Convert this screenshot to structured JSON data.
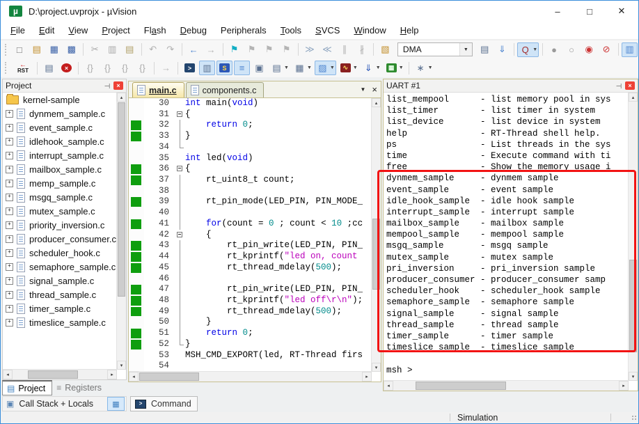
{
  "window": {
    "title": "D:\\project.uvprojx - µVision"
  },
  "menu": {
    "items": [
      {
        "label": "File",
        "u": 0
      },
      {
        "label": "Edit",
        "u": 0
      },
      {
        "label": "View",
        "u": 0
      },
      {
        "label": "Project",
        "u": 0
      },
      {
        "label": "Flash",
        "u": 2
      },
      {
        "label": "Debug",
        "u": 0
      },
      {
        "label": "Peripherals",
        "u": -1
      },
      {
        "label": "Tools",
        "u": 0
      },
      {
        "label": "SVCS",
        "u": 0
      },
      {
        "label": "Window",
        "u": 0
      },
      {
        "label": "Help",
        "u": 0
      }
    ]
  },
  "toolbars": {
    "target_value": "DMA",
    "main": [
      {
        "n": "new-file-icon",
        "g": "□",
        "c": "#6f6f6f"
      },
      {
        "n": "open-file-icon",
        "g": "▤",
        "c": "#c28f2c"
      },
      {
        "n": "save-icon",
        "g": "▦",
        "c": "#3b62a8"
      },
      {
        "n": "save-all-icon",
        "g": "▩",
        "c": "#3b62a8"
      },
      {
        "t": "sep"
      },
      {
        "n": "cut-icon",
        "g": "✂",
        "c": "#a9a9a9"
      },
      {
        "n": "copy-icon",
        "g": "▥",
        "c": "#a9a9a9"
      },
      {
        "n": "paste-icon",
        "g": "▤",
        "c": "#b1a06a"
      },
      {
        "t": "sep"
      },
      {
        "n": "undo-icon",
        "g": "↶",
        "c": "#b0b0b0"
      },
      {
        "n": "redo-icon",
        "g": "↷",
        "c": "#b0b0b0"
      },
      {
        "t": "sep"
      },
      {
        "n": "navigate-back-icon",
        "g": "←",
        "c": "#4f86d0"
      },
      {
        "n": "navigate-forward-icon",
        "g": "→",
        "c": "#b4b4b4"
      },
      {
        "t": "sep"
      },
      {
        "n": "bookmark-toggle-icon",
        "g": "⚑",
        "c": "#12aec4"
      },
      {
        "n": "bookmark-prev-icon",
        "g": "⚑",
        "c": "#b4b4b4"
      },
      {
        "n": "bookmark-next-icon",
        "g": "⚑",
        "c": "#b4b4b4"
      },
      {
        "n": "bookmark-clear-icon",
        "g": "⚑",
        "c": "#b4b4b4"
      },
      {
        "t": "sep"
      },
      {
        "n": "indent-icon",
        "g": "≫",
        "c": "#93a9c2"
      },
      {
        "n": "outdent-icon",
        "g": "≪",
        "c": "#93a9c2"
      },
      {
        "n": "comment-icon",
        "g": "∥",
        "c": "#b0b0b0"
      },
      {
        "n": "uncomment-icon",
        "g": "∦",
        "c": "#b0b0b0"
      },
      {
        "t": "sep"
      },
      {
        "n": "flash-download-icon",
        "g": "▧",
        "c": "#c28f2c"
      },
      {
        "t": "combo"
      },
      {
        "n": "target-options-icon",
        "g": "▤",
        "c": "#5a7090"
      },
      {
        "n": "find-in-files-icon",
        "g": "⇓",
        "c": "#4f86d0"
      },
      {
        "t": "sep"
      },
      {
        "n": "search-icon",
        "g": "Q",
        "c": "#a32c2c",
        "hl": 1,
        "dd": 1
      },
      {
        "t": "sep"
      },
      {
        "n": "breakpoint-insert-icon",
        "g": "●",
        "c": "#9a9a9a"
      },
      {
        "n": "breakpoint-remove-icon",
        "g": "○",
        "c": "#9a9a9a"
      },
      {
        "n": "breakpoint-enable-icon",
        "g": "◉",
        "c": "#c33"
      },
      {
        "n": "breakpoint-kill-icon",
        "g": "⊘",
        "c": "#c33"
      },
      {
        "t": "sep"
      },
      {
        "n": "window-layout-icon",
        "g": "▥",
        "c": "#4f86d0",
        "hl": 1
      }
    ],
    "debug": [
      {
        "t": "rst",
        "n": "reset-cpu-button",
        "label": "RST",
        "arrow": "←"
      },
      {
        "t": "sep"
      },
      {
        "n": "run-to-line-icon",
        "g": "▤",
        "c": "#5a7090"
      },
      {
        "n": "stop-icon",
        "g": "×",
        "c": "#fff",
        "bg": "#c41e1e",
        "round": 1
      },
      {
        "t": "sep"
      },
      {
        "n": "step-icon",
        "g": "{}",
        "c": "#ababab"
      },
      {
        "n": "step-over-icon",
        "g": "{}",
        "c": "#ababab"
      },
      {
        "n": "step-out-icon",
        "g": "{}",
        "c": "#ababab"
      },
      {
        "n": "run-to-cursor-icon",
        "g": "{}",
        "c": "#ababab"
      },
      {
        "t": "sep"
      },
      {
        "n": "next-statement-icon",
        "g": "→",
        "c": "#b8b8b8"
      },
      {
        "t": "sep"
      },
      {
        "n": "command-window-icon",
        "g": ">",
        "c": "#fff",
        "bg": "#23456e"
      },
      {
        "n": "disassembly-window-icon",
        "g": "▥",
        "c": "#5a7090",
        "hl": 1
      },
      {
        "n": "symbols-window-icon",
        "g": "S",
        "c": "#ffd84a",
        "bg": "#2b57b8",
        "hl": 1
      },
      {
        "n": "registers-window-icon",
        "g": "≡",
        "c": "#4f86d0",
        "hl": 1
      },
      {
        "n": "callstack-window-icon",
        "g": "▣",
        "c": "#5a7090"
      },
      {
        "n": "watch-window-icon",
        "g": "▤",
        "c": "#5a7090",
        "dd": 1
      },
      {
        "n": "memory-window-icon",
        "g": "▦",
        "c": "#5a7090",
        "dd": 1
      },
      {
        "n": "serial-window-icon",
        "g": "▨",
        "c": "#4f86d0",
        "hl": 1,
        "dd": 1
      },
      {
        "n": "analysis-window-icon",
        "g": "∿",
        "c": "#ffdf60",
        "bg": "#8a2020",
        "dd": 1
      },
      {
        "n": "trace-window-icon",
        "g": "⇓",
        "c": "#2b57b8",
        "dd": 1
      },
      {
        "n": "system-viewer-icon",
        "g": "▦",
        "c": "#eaffea",
        "bg": "#2f8b2f",
        "dd": 1
      },
      {
        "t": "sep"
      },
      {
        "n": "toolbox-icon",
        "g": "∗",
        "c": "#5a7090",
        "dd": 1
      }
    ]
  },
  "project": {
    "title": "Project",
    "root": "kernel-sample",
    "files": [
      "dynmem_sample.c",
      "event_sample.c",
      "idlehook_sample.c",
      "interrupt_sample.c",
      "mailbox_sample.c",
      "memp_sample.c",
      "msgq_sample.c",
      "mutex_sample.c",
      "priority_inversion.c",
      "producer_consumer.c",
      "scheduler_hook.c",
      "semaphore_sample.c",
      "signal_sample.c",
      "thread_sample.c",
      "timer_sample.c",
      "timeslice_sample.c"
    ],
    "tabs": [
      {
        "label": "Project",
        "active": true
      },
      {
        "label": "Registers",
        "active": false
      }
    ]
  },
  "editor": {
    "tabs": [
      {
        "label": "main.c",
        "active": true
      },
      {
        "label": "components.c",
        "active": false
      }
    ],
    "lines": [
      {
        "n": 30,
        "g": 0,
        "f": "",
        "s": [
          [
            "k",
            "int"
          ],
          [
            "p",
            " main("
          ],
          [
            "k",
            "void"
          ],
          [
            "p",
            ")"
          ]
        ]
      },
      {
        "n": 31,
        "g": 0,
        "f": "b",
        "s": [
          [
            "p",
            "{"
          ]
        ]
      },
      {
        "n": 32,
        "g": 1,
        "f": "l",
        "s": [
          [
            "p",
            "    "
          ],
          [
            "k",
            "return"
          ],
          [
            "p",
            " "
          ],
          [
            "nu",
            "0"
          ],
          [
            "p",
            ";"
          ]
        ]
      },
      {
        "n": 33,
        "g": 1,
        "f": "l",
        "s": [
          [
            "p",
            "}"
          ]
        ]
      },
      {
        "n": 34,
        "g": 0,
        "f": "e",
        "s": []
      },
      {
        "n": 35,
        "g": 0,
        "f": "",
        "s": [
          [
            "k",
            "int"
          ],
          [
            "p",
            " led("
          ],
          [
            "k",
            "void"
          ],
          [
            "p",
            ")"
          ]
        ]
      },
      {
        "n": 36,
        "g": 1,
        "f": "b",
        "s": [
          [
            "p",
            "{"
          ]
        ]
      },
      {
        "n": 37,
        "g": 1,
        "f": "l",
        "s": [
          [
            "p",
            "    rt_uint8_t count;"
          ]
        ]
      },
      {
        "n": 38,
        "g": 0,
        "f": "l",
        "s": []
      },
      {
        "n": 39,
        "g": 1,
        "f": "l",
        "s": [
          [
            "p",
            "    rt_pin_mode(LED_PIN, PIN_MODE_"
          ]
        ]
      },
      {
        "n": 40,
        "g": 0,
        "f": "l",
        "s": []
      },
      {
        "n": 41,
        "g": 1,
        "f": "l",
        "s": [
          [
            "p",
            "    "
          ],
          [
            "k",
            "for"
          ],
          [
            "p",
            "(count = "
          ],
          [
            "nu",
            "0"
          ],
          [
            "p",
            " ; count < "
          ],
          [
            "nu",
            "10"
          ],
          [
            "p",
            " ;cc"
          ]
        ]
      },
      {
        "n": 42,
        "g": 0,
        "f": "b",
        "s": [
          [
            "p",
            "    {"
          ]
        ]
      },
      {
        "n": 43,
        "g": 1,
        "f": "l",
        "s": [
          [
            "p",
            "        rt_pin_write(LED_PIN, PIN_"
          ]
        ]
      },
      {
        "n": 44,
        "g": 1,
        "f": "l",
        "s": [
          [
            "p",
            "        rt_kprintf("
          ],
          [
            "st",
            "\"led on, count"
          ]
        ]
      },
      {
        "n": 45,
        "g": 1,
        "f": "l",
        "s": [
          [
            "p",
            "        rt_thread_mdelay("
          ],
          [
            "nu",
            "500"
          ],
          [
            "p",
            ");"
          ]
        ]
      },
      {
        "n": 46,
        "g": 0,
        "f": "l",
        "s": []
      },
      {
        "n": 47,
        "g": 1,
        "f": "l",
        "s": [
          [
            "p",
            "        rt_pin_write(LED_PIN, PIN_"
          ]
        ]
      },
      {
        "n": 48,
        "g": 1,
        "f": "l",
        "s": [
          [
            "p",
            "        rt_kprintf("
          ],
          [
            "st",
            "\"led off\\r\\n\""
          ],
          [
            "p",
            ");"
          ]
        ]
      },
      {
        "n": 49,
        "g": 1,
        "f": "l",
        "s": [
          [
            "p",
            "        rt_thread_mdelay("
          ],
          [
            "nu",
            "500"
          ],
          [
            "p",
            ");"
          ]
        ]
      },
      {
        "n": 50,
        "g": 0,
        "f": "l",
        "s": [
          [
            "p",
            "    }"
          ]
        ]
      },
      {
        "n": 51,
        "g": 1,
        "f": "l",
        "s": [
          [
            "p",
            "    "
          ],
          [
            "k",
            "return"
          ],
          [
            "p",
            " "
          ],
          [
            "nu",
            "0"
          ],
          [
            "p",
            ";"
          ]
        ]
      },
      {
        "n": 52,
        "g": 1,
        "f": "e",
        "s": [
          [
            "p",
            "}"
          ]
        ]
      },
      {
        "n": 53,
        "g": 0,
        "f": "",
        "s": [
          [
            "p",
            "MSH_CMD_EXPORT(led, RT-Thread firs"
          ]
        ]
      },
      {
        "n": 54,
        "g": 0,
        "f": "",
        "s": []
      }
    ]
  },
  "uart": {
    "title": "UART #1",
    "lines": [
      "list_mempool      - list memory pool in sys",
      "list_timer        - list timer in system",
      "list_device       - list device in system",
      "help              - RT-Thread shell help.",
      "ps                - List threads in the sys",
      "time              - Execute command with ti",
      "free              - Show the memory usage i",
      "dynmem_sample     - dynmem sample",
      "event_sample      - event sample",
      "idle_hook_sample  - idle hook sample",
      "interrupt_sample  - interrupt sample",
      "mailbox_sample    - mailbox sample",
      "mempool_sample    - mempool sample",
      "msgq_sample       - msgq sample",
      "mutex_sample      - mutex sample",
      "pri_inversion     - pri_inversion sample",
      "producer_consumer - producer_consumer samp",
      "scheduler_hook    - scheduler_hook sample",
      "semaphore_sample  - semaphore sample",
      "signal_sample     - signal sample",
      "thread_sample     - thread sample",
      "timer_sample      - timer sample",
      "timeslice_sample  - timeslice sample",
      "",
      "msh >"
    ]
  },
  "bottom": {
    "callstack_label": "Call Stack + Locals",
    "command_label": "Command",
    "status": "Simulation"
  },
  "colors": {
    "annotation_red": "#f21313",
    "modified_green": "#0f9e0f",
    "keyword_blue": "#0000e6",
    "number_teal": "#008b8b",
    "string_magenta": "#bb00bb",
    "window_border_blue": "#2f86d2"
  }
}
